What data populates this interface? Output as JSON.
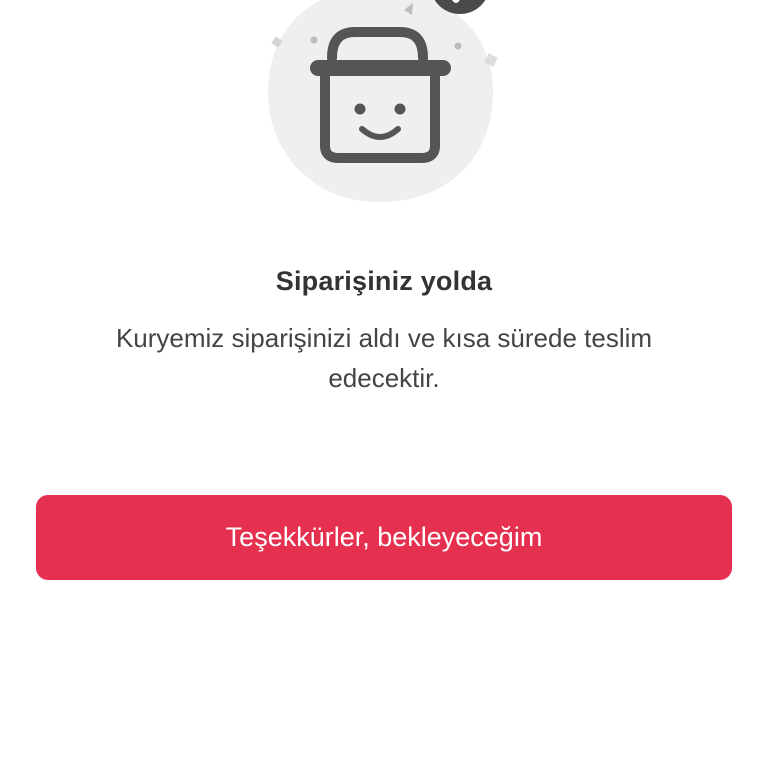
{
  "status": {
    "title": "Siparişiniz yolda",
    "message": "Kuryemiz siparişinizi aldı ve kısa sürede teslim edecektir."
  },
  "actions": {
    "confirm_label": "Teşekkürler, bekleyeceğim"
  },
  "illustration": {
    "icon": "smiling-basket-icon",
    "badge_icon": "checkmark-badge-icon"
  },
  "colors": {
    "primary": "#e5304f",
    "icon_stroke": "#555555",
    "blob": "#efefef",
    "title_text": "#333333",
    "body_text": "#444444"
  }
}
